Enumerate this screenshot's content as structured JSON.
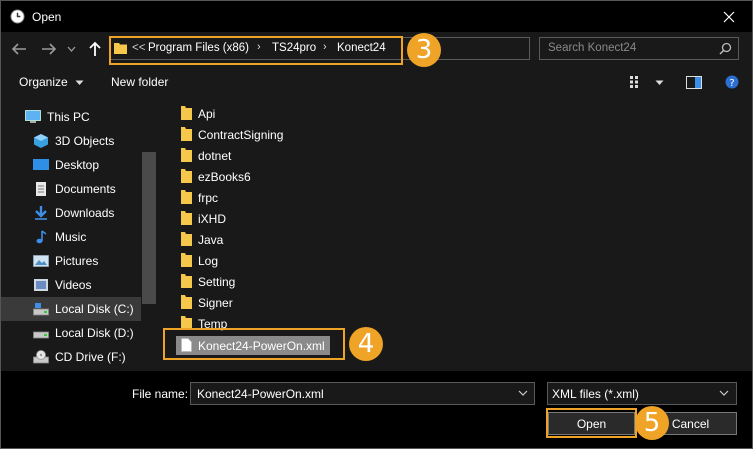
{
  "window": {
    "title": "Open"
  },
  "nav": {
    "overflow_label": "<<",
    "breadcrumb": [
      "Program Files (x86)",
      "TS24pro",
      "Konect24"
    ],
    "search_placeholder": "Search Konect24"
  },
  "toolbar": {
    "organize_label": "Organize",
    "new_folder_label": "New folder"
  },
  "sidebar": {
    "items": [
      {
        "label": "This PC",
        "icon": "pc-icon"
      },
      {
        "label": "3D Objects",
        "icon": "cube-icon"
      },
      {
        "label": "Desktop",
        "icon": "desktop-icon"
      },
      {
        "label": "Documents",
        "icon": "documents-icon"
      },
      {
        "label": "Downloads",
        "icon": "download-icon"
      },
      {
        "label": "Music",
        "icon": "music-icon"
      },
      {
        "label": "Pictures",
        "icon": "pictures-icon"
      },
      {
        "label": "Videos",
        "icon": "videos-icon"
      },
      {
        "label": "Local Disk (C:)",
        "icon": "drive-icon",
        "selected": true
      },
      {
        "label": "Local Disk (D:)",
        "icon": "drive-icon"
      },
      {
        "label": "CD Drive (F:)",
        "icon": "cd-drive-icon"
      }
    ]
  },
  "files": {
    "items": [
      {
        "name": "Api",
        "type": "folder"
      },
      {
        "name": "ContractSigning",
        "type": "folder"
      },
      {
        "name": "dotnet",
        "type": "folder"
      },
      {
        "name": "ezBooks6",
        "type": "folder"
      },
      {
        "name": "frpc",
        "type": "folder"
      },
      {
        "name": "iXHD",
        "type": "folder"
      },
      {
        "name": "Java",
        "type": "folder"
      },
      {
        "name": "Log",
        "type": "folder"
      },
      {
        "name": "Setting",
        "type": "folder"
      },
      {
        "name": "Signer",
        "type": "folder"
      },
      {
        "name": "Temp",
        "type": "folder"
      },
      {
        "name": "Konect24-PowerOn.xml",
        "type": "file",
        "selected": true
      }
    ]
  },
  "bottom": {
    "file_name_label": "File name:",
    "file_name_value": "Konect24-PowerOn.xml",
    "file_type_value": "XML files (*.xml)",
    "open_label": "Open",
    "cancel_label": "Cancel"
  },
  "callouts": {
    "step3": "3",
    "step4": "4",
    "step5": "5"
  },
  "colors": {
    "accent": "#f0a427",
    "folder": "#f5c84c",
    "window_bg": "#191919",
    "titlebar_bg": "#000000",
    "selection": "#8a8a8a"
  }
}
